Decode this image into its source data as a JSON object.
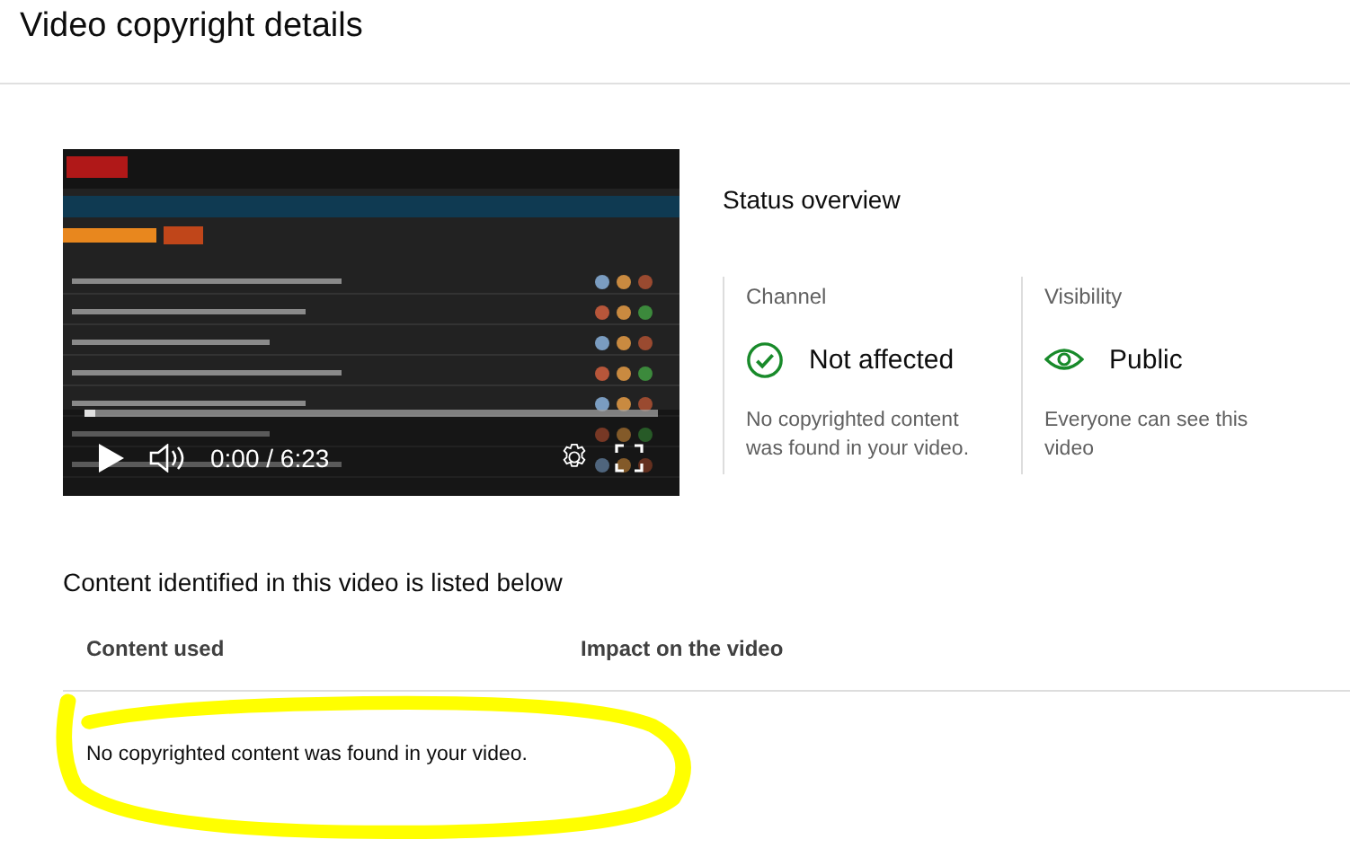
{
  "header": {
    "title": "Video copyright details"
  },
  "video": {
    "kind": "picture",
    "time": "0:00 / 6:23",
    "progress": {
      "level": 0.02
    }
  },
  "status": {
    "title": "Status overview",
    "cards": [
      {
        "label": "Channel",
        "kind": "check",
        "value": "Not affected",
        "description": "No copyrighted content was found in your video."
      },
      {
        "label": "Visibility",
        "kind": "eye",
        "value": "Public",
        "description": "Everyone can see this video"
      }
    ]
  },
  "content": {
    "heading": "Content identified in this video is listed below",
    "columns": [
      "Content used",
      "Impact on the video"
    ],
    "empty_message": "No copyrighted content was found in your video."
  }
}
